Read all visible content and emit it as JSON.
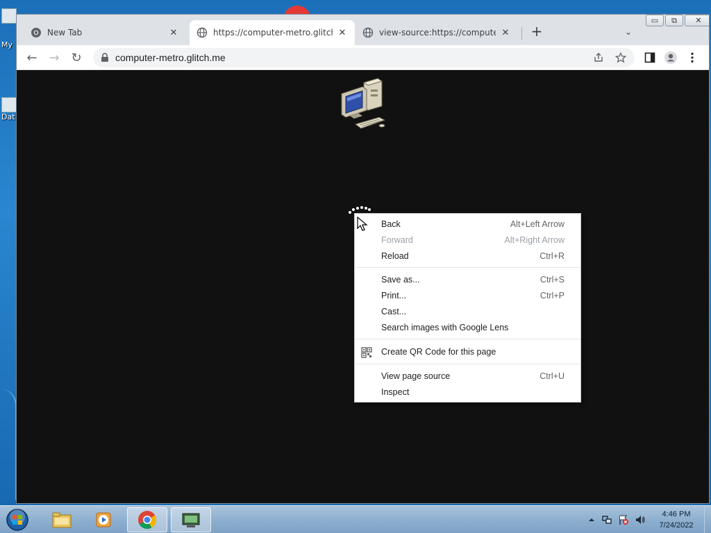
{
  "desktop": {
    "icon_labels": [
      "My",
      "Dat"
    ]
  },
  "browser": {
    "tabs": [
      {
        "title": "New Tab",
        "close": "✕",
        "icon": "chrome-icon",
        "active": false
      },
      {
        "title": "https://computer-metro.glitch.me",
        "close": "✕",
        "icon": "globe-icon",
        "active": true
      },
      {
        "title": "view-source:https://computer-metro.glitch.me",
        "close": "✕",
        "icon": "globe-icon",
        "active": false
      }
    ],
    "new_tab_glyph": "+",
    "tab_search_glyph": "⌄",
    "window_controls": {
      "minimize": "▭",
      "restore": "⧉",
      "close": "✕"
    },
    "toolbar": {
      "back_glyph": "←",
      "forward_glyph": "→",
      "reload_glyph": "↻",
      "url": "computer-metro.glitch.me"
    }
  },
  "context_menu": {
    "items": [
      {
        "label": "Back",
        "shortcut": "Alt+Left Arrow",
        "enabled": true
      },
      {
        "label": "Forward",
        "shortcut": "Alt+Right Arrow",
        "enabled": false
      },
      {
        "label": "Reload",
        "shortcut": "Ctrl+R",
        "enabled": true
      },
      {
        "label": "Save as...",
        "shortcut": "Ctrl+S",
        "enabled": true
      },
      {
        "label": "Print...",
        "shortcut": "Ctrl+P",
        "enabled": true
      },
      {
        "label": "Cast...",
        "shortcut": "",
        "enabled": true
      },
      {
        "label": "Search images with Google Lens",
        "shortcut": "",
        "enabled": true
      },
      {
        "label": "Create QR Code for this page",
        "shortcut": "",
        "enabled": true,
        "icon": "qr-code-icon"
      },
      {
        "label": "View page source",
        "shortcut": "Ctrl+U",
        "enabled": true
      },
      {
        "label": "Inspect",
        "shortcut": "",
        "enabled": true
      }
    ]
  },
  "taskbar": {
    "apps": [
      "file-explorer",
      "media-player",
      "chrome",
      "computer-app"
    ],
    "active_app": "chrome",
    "clock": {
      "time": "4:46 PM",
      "date": "7/24/2022"
    }
  },
  "colors": {
    "page_background": "#111111",
    "tabstrip": "#dee1e6",
    "disabled_text": "#9aa0a6"
  }
}
